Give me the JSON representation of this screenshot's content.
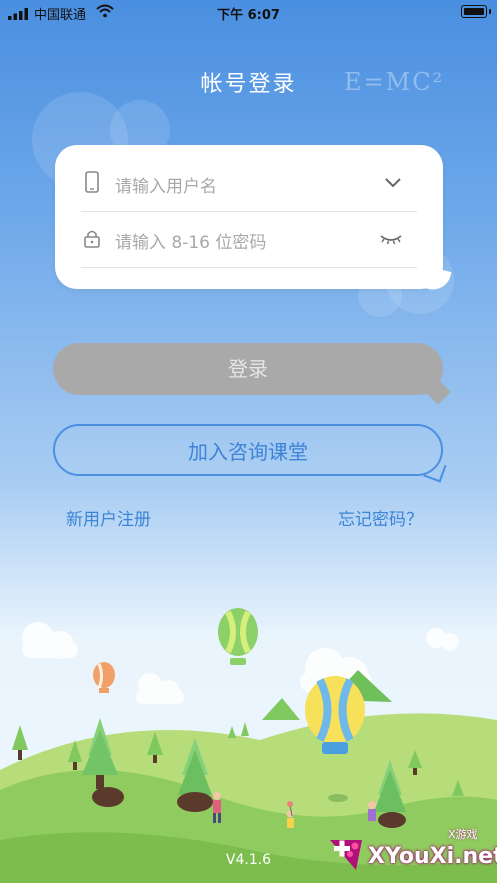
{
  "status_bar": {
    "carrier": "中国联通",
    "time": "下午 6:07"
  },
  "header": {
    "title": "帐号登录",
    "decoration": "E=MC²"
  },
  "form": {
    "username_placeholder": "请输入用户名",
    "password_placeholder": "请输入 8-16 位密码"
  },
  "buttons": {
    "login": "登录",
    "join": "加入咨询课堂"
  },
  "links": {
    "register": "新用户注册",
    "forgot": "忘记密码？"
  },
  "version": "V4.1.6",
  "watermark": {
    "text": "XYouXi.net",
    "small": "X游戏"
  },
  "colors": {
    "accent": "#3d84d6",
    "login_disabled": "#a9a9a9"
  }
}
